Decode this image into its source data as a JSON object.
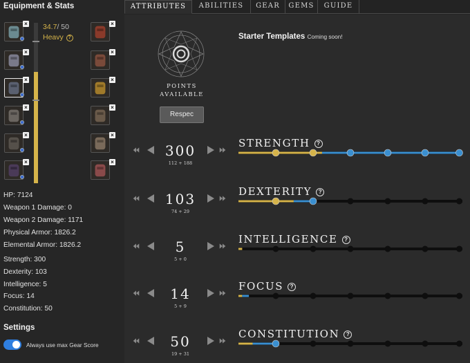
{
  "equipment": {
    "title": "Equipment & Stats",
    "weight": {
      "current": "34.7",
      "max": "/ 50",
      "class": "Heavy",
      "fraction": 0.694
    },
    "slots": [
      {
        "name": "helmet",
        "color": "#6b8a90"
      },
      {
        "name": "chest",
        "color": "#7a7a8a"
      },
      {
        "name": "gloves",
        "color": "#5a6070"
      },
      {
        "name": "pants",
        "color": "#6a6560"
      },
      {
        "name": "boots",
        "color": "#55504a"
      },
      {
        "name": "shield",
        "color": "#4a3a58"
      },
      {
        "name": "weapon-1",
        "color": "#8a3a2a"
      },
      {
        "name": "weapon-2",
        "color": "#7a4a3a"
      },
      {
        "name": "amulet",
        "color": "#a07a2a"
      },
      {
        "name": "bag",
        "color": "#6a5a4a"
      },
      {
        "name": "ring",
        "color": "#7a6a5a"
      },
      {
        "name": "earring",
        "color": "#8a4a4a"
      }
    ],
    "stats": [
      "HP: 7124",
      "Weapon 1 Damage: 0",
      "Weapon 2 Damage: 1171",
      "Physical Armor: 1826.2",
      "Elemental Armor: 1826.2"
    ],
    "attr_stats": [
      "Strength: 300",
      "Dexterity: 103",
      "Intelligence: 5",
      "Focus: 14",
      "Constitution: 50"
    ]
  },
  "settings": {
    "title": "Settings",
    "toggle_label": "Always use max Gear Score",
    "toggle_on": true
  },
  "tabs": [
    {
      "label": "ATTRIBUTES",
      "active": true
    },
    {
      "label": "ABILITIES",
      "active": false
    },
    {
      "label": "GEAR",
      "active": false
    },
    {
      "label": "GEMS",
      "active": false
    },
    {
      "label": "GUIDE",
      "active": false
    }
  ],
  "points": {
    "line1": "POINTS",
    "line2": "AVAILABLE"
  },
  "respec_label": "Respec",
  "templates": {
    "title": "Starter Templates",
    "note": "Coming soon!"
  },
  "colors": {
    "gold": "#d6b44a",
    "blue": "#3a8fd0",
    "node_dark": "#0e0e0e"
  },
  "attributes": [
    {
      "name": "STRENGTH",
      "value": "300",
      "breakdown": "112 + 188",
      "gold": 112,
      "blue": 188,
      "lit_nodes": 6
    },
    {
      "name": "DEXTERITY",
      "value": "103",
      "breakdown": "74 + 29",
      "gold": 74,
      "blue": 29,
      "lit_nodes": 2
    },
    {
      "name": "INTELLIGENCE",
      "value": "5",
      "breakdown": "5 + 0",
      "gold": 5,
      "blue": 0,
      "lit_nodes": 0
    },
    {
      "name": "FOCUS",
      "value": "14",
      "breakdown": "5 + 9",
      "gold": 5,
      "blue": 9,
      "lit_nodes": 0
    },
    {
      "name": "CONSTITUTION",
      "value": "50",
      "breakdown": "19 + 31",
      "gold": 19,
      "blue": 31,
      "lit_nodes": 1
    }
  ],
  "attribute_max": 300,
  "node_thresholds": [
    50,
    100,
    150,
    200,
    250,
    300
  ]
}
